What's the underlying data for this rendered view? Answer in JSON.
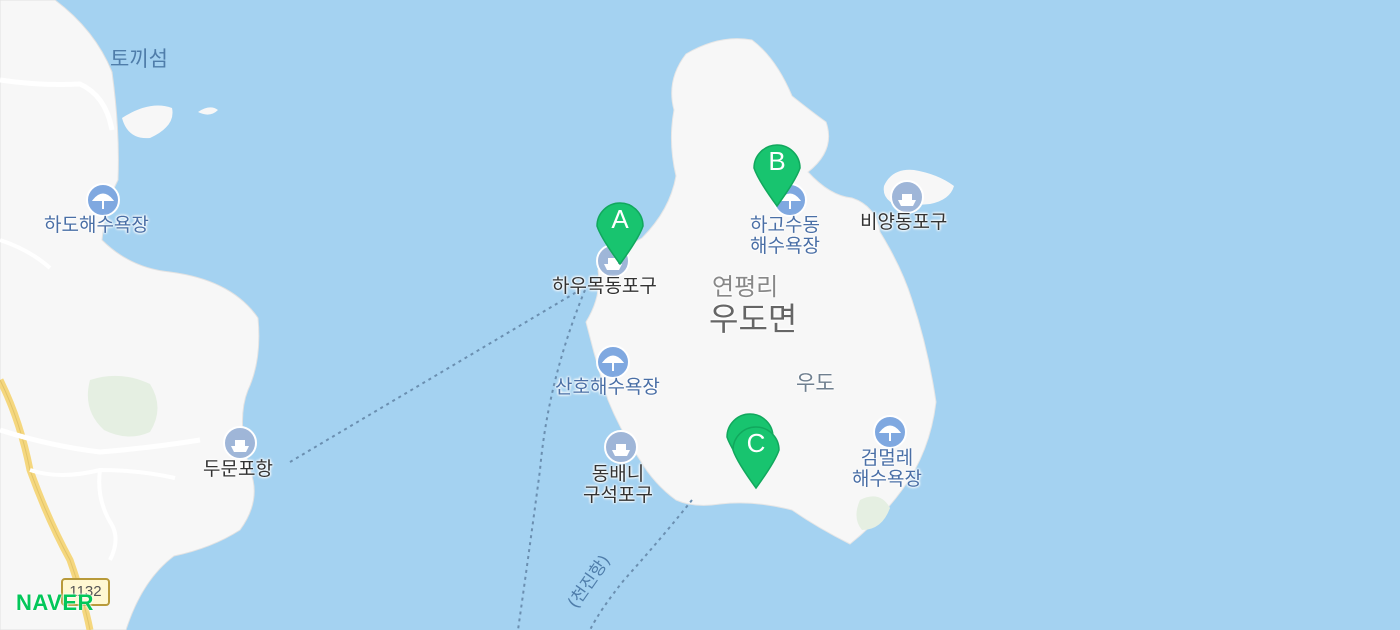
{
  "map": {
    "areas": {
      "village": "연평리",
      "district": "우도면",
      "island": "우도"
    },
    "places": {
      "tokki": "토끼섬",
      "hado_beach": "하도해수욕장",
      "haumok_port": "하우목동포구",
      "hagosu_beach": "하고수동\n해수욕장",
      "biyang_port": "비양동포구",
      "sanho_beach": "산호해수욕장",
      "dongbaeni_port": "동배니\n구석포구",
      "dumun_port": "두문포항",
      "geommeolle_beach": "검멀레\n해수욕장"
    },
    "route_number": "1132",
    "ferry_route_label": "(천진항)",
    "brand": "NAVER",
    "markers": [
      {
        "letter": "A",
        "name": "하우목동포구"
      },
      {
        "letter": "B",
        "name": "하고수동 해수욕장"
      },
      {
        "letter": "C",
        "name": ""
      }
    ],
    "colors": {
      "sea": "#a4d2f1",
      "land": "#f7f7f7",
      "marker": "#18c46f",
      "road_yellow": "#f5d77e",
      "label_blue": "#4a6fa6",
      "brand": "#03c75a"
    },
    "icons": {
      "beach": "beach-umbrella-icon",
      "port": "ferry-icon",
      "marker": "map-pin-icon"
    }
  }
}
